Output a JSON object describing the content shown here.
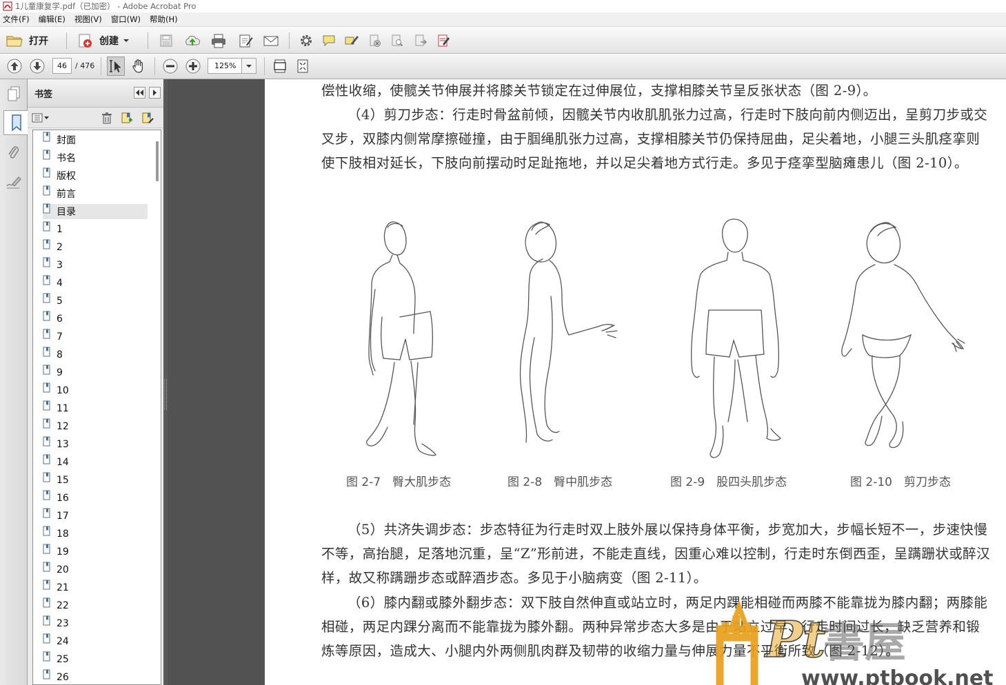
{
  "window": {
    "title": "1儿童康复学.pdf（已加密） - Adobe Acrobat Pro"
  },
  "menu": [
    "文件(F)",
    "编辑(E)",
    "视图(V)",
    "窗口(W)",
    "帮助(H)"
  ],
  "toolbar": {
    "open_label": "打开",
    "create_label": "创建"
  },
  "nav": {
    "page": "46",
    "total": "/ 476",
    "zoom": "125%"
  },
  "bookmarks": {
    "title": "书签",
    "items": [
      "封面",
      "书名",
      "版权",
      "前言",
      "目录",
      "1",
      "2",
      "3",
      "4",
      "5",
      "6",
      "7",
      "8",
      "9",
      "10",
      "11",
      "12",
      "13",
      "14",
      "15",
      "16",
      "17",
      "18",
      "19",
      "20",
      "21",
      "22",
      "23",
      "24",
      "25",
      "26"
    ],
    "selected_index": 4
  },
  "doc": {
    "p1": "偿性收缩，使髋关节伸展并将膝关节锁定在过伸展位，支撑相膝关节呈反张状态（图 2-9）。",
    "p2": "（4）剪刀步态：行走时骨盆前倾，因髋关节内收肌肌张力过高，行走时下肢向前内侧迈出，呈剪刀步或交叉步，双膝内侧常摩擦碰撞，由于腘绳肌张力过高，支撑相膝关节仍保持屈曲，足尖着地，小腿三头肌痉挛则使下肢相对延长，下肢向前摆动时足趾拖地，并以足尖着地方式行走。多见于痉挛型脑瘫患儿（图 2-10）。",
    "captions": [
      "图 2-7　臀大肌步态",
      "图 2-8　臀中肌步态",
      "图 2-9　股四头肌步态",
      "图 2-10　剪刀步态"
    ],
    "p3": "（5）共济失调步态：步态特征为行走时双上肢外展以保持身体平衡，步宽加大，步幅长短不一，步速快慢不等，高抬腿，足落地沉重，呈“Z”形前进，不能走直线，因重心难以控制，行走时东倒西歪，呈蹒跚状或醉汉样，故又称蹒跚步态或醉酒步态。多见于小脑病变（图 2-11）。",
    "p4": "（6）膝内翻或膝外翻步态：双下肢自然伸直或站立时，两足内踝能相碰而两膝不能靠拢为膝内翻；两膝能相碰，两足内踝分离而不能靠拢为膝外翻。两种异常步态大多是由于站立过早、行走时间过长，缺乏营养和锻炼等原因，造成大、小腿内外两侧肌肉群及韧带的收缩力量与伸展力量不平衡所致（图 2-12）。"
  },
  "watermark": {
    "brand": "PT書屋",
    "url": "www.ptbook.net"
  },
  "colors": {
    "viewer_bg": "#525252",
    "watermark_orange": "#e8a11c"
  }
}
